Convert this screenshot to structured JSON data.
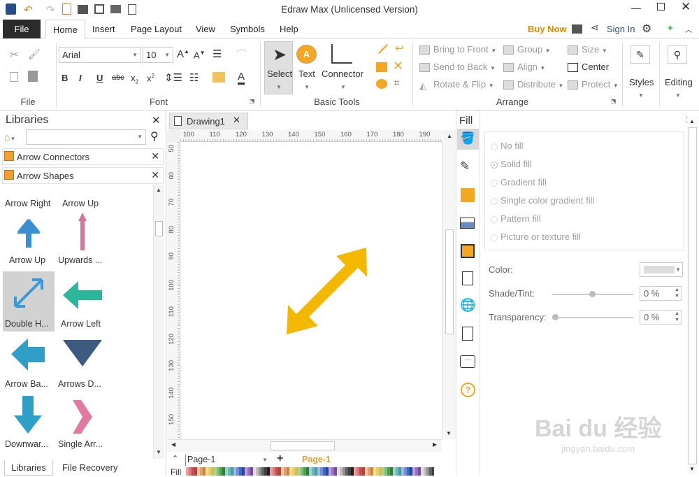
{
  "app": {
    "title": "Edraw Max (Unlicensed Version)"
  },
  "menu": {
    "file": "File",
    "tabs": [
      "Home",
      "Insert",
      "Page Layout",
      "View",
      "Symbols",
      "Help"
    ],
    "buy_now": "Buy Now",
    "sign_in": "Sign In"
  },
  "ribbon": {
    "font_name": "Arial",
    "font_size": "10",
    "groups": {
      "file": "File",
      "font": "Font",
      "basic_tools": "Basic Tools",
      "arrange": "Arrange"
    },
    "tools": {
      "select": "Select",
      "text": "Text",
      "connector": "Connector"
    },
    "arrange": {
      "bring_to_front": "Bring to Front",
      "send_to_back": "Send to Back",
      "rotate_flip": "Rotate & Flip",
      "group": "Group",
      "align": "Align",
      "distribute": "Distribute",
      "size": "Size",
      "center": "Center",
      "protect": "Protect"
    },
    "styles": "Styles",
    "editing": "Editing"
  },
  "libraries": {
    "title": "Libraries",
    "sections": [
      "Arrow Connectors",
      "Arrow Shapes"
    ],
    "shapes_row0": [
      "Arrow Right",
      "Arrow Up"
    ],
    "shapes": [
      {
        "label": "Arrow Up",
        "color": "#3a8fd0"
      },
      {
        "label": "Upwards ...",
        "color": "#d9739a"
      },
      {
        "label": "Double H...",
        "color": "#3a9ad8"
      },
      {
        "label": "Arrow Left",
        "color": "#2bb89a"
      },
      {
        "label": "Arrow Ba...",
        "color": "#2f9fc8"
      },
      {
        "label": "Arrows D...",
        "color": "#3d5a80"
      },
      {
        "label": "Downwar...",
        "color": "#2f9fc8"
      },
      {
        "label": "Single Arr...",
        "color": "#e07aa0"
      }
    ],
    "bottom_tabs": [
      "Libraries",
      "File Recovery"
    ]
  },
  "document": {
    "tab": "Drawing1",
    "ruler_h": [
      "100",
      "110",
      "120",
      "130",
      "140",
      "150",
      "160",
      "170",
      "180",
      "190"
    ],
    "ruler_v": [
      "50",
      "60",
      "70",
      "80",
      "90",
      "100",
      "110",
      "120",
      "130",
      "140",
      "150"
    ],
    "arrow_color": "#f5b800",
    "page_selector": "Page-1",
    "page_tab": "Page-1",
    "fill_label": "Fill"
  },
  "fill_panel": {
    "title": "Fill",
    "options": [
      "No fill",
      "Solid fill",
      "Gradient fill",
      "Single color gradient fill",
      "Pattern fill",
      "Picture or texture fill"
    ],
    "color_label": "Color:",
    "shade_label": "Shade/Tint:",
    "shade_value": "0 %",
    "transparency_label": "Transparency:",
    "transparency_value": "0 %"
  },
  "watermark": {
    "text": "Bai du 经验",
    "url": "jingyan.baidu.com"
  }
}
